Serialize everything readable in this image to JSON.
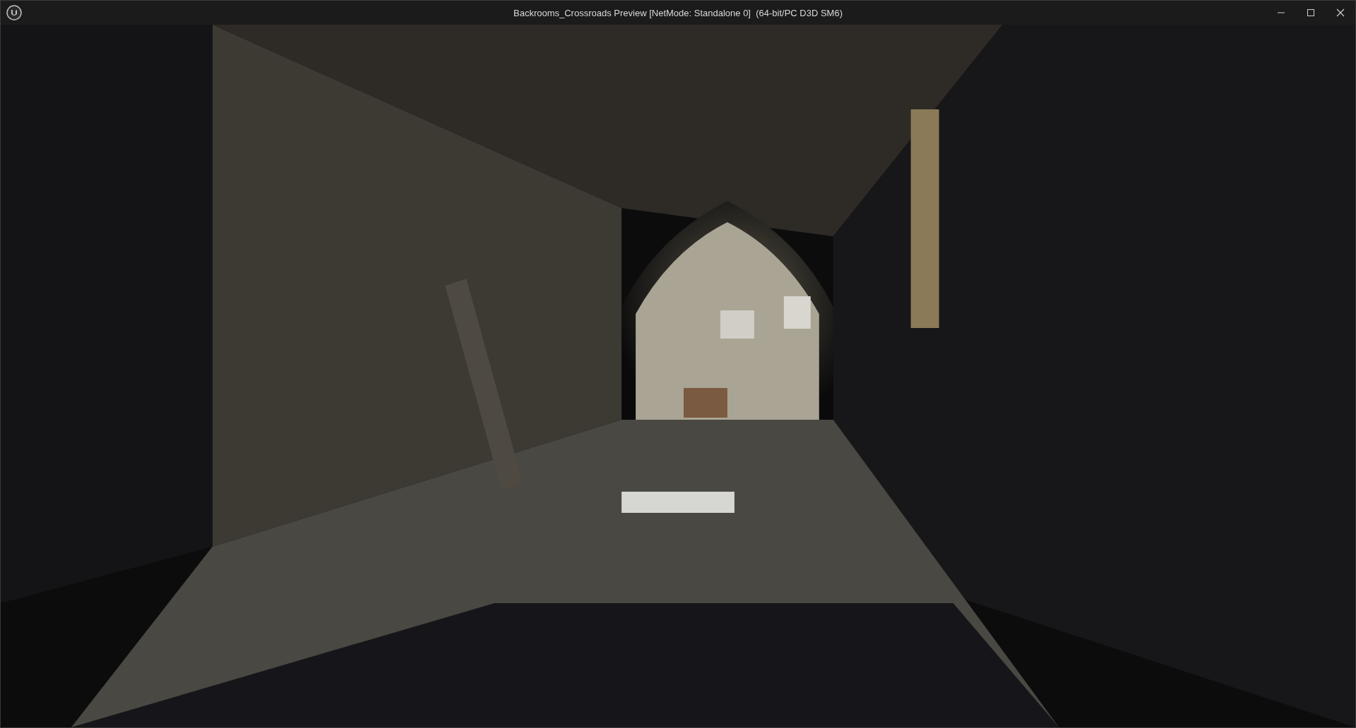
{
  "window": {
    "title": "Backrooms_Crossroads Preview [NetMode: Standalone 0]  (64-bit/PC D3D SM6)"
  }
}
